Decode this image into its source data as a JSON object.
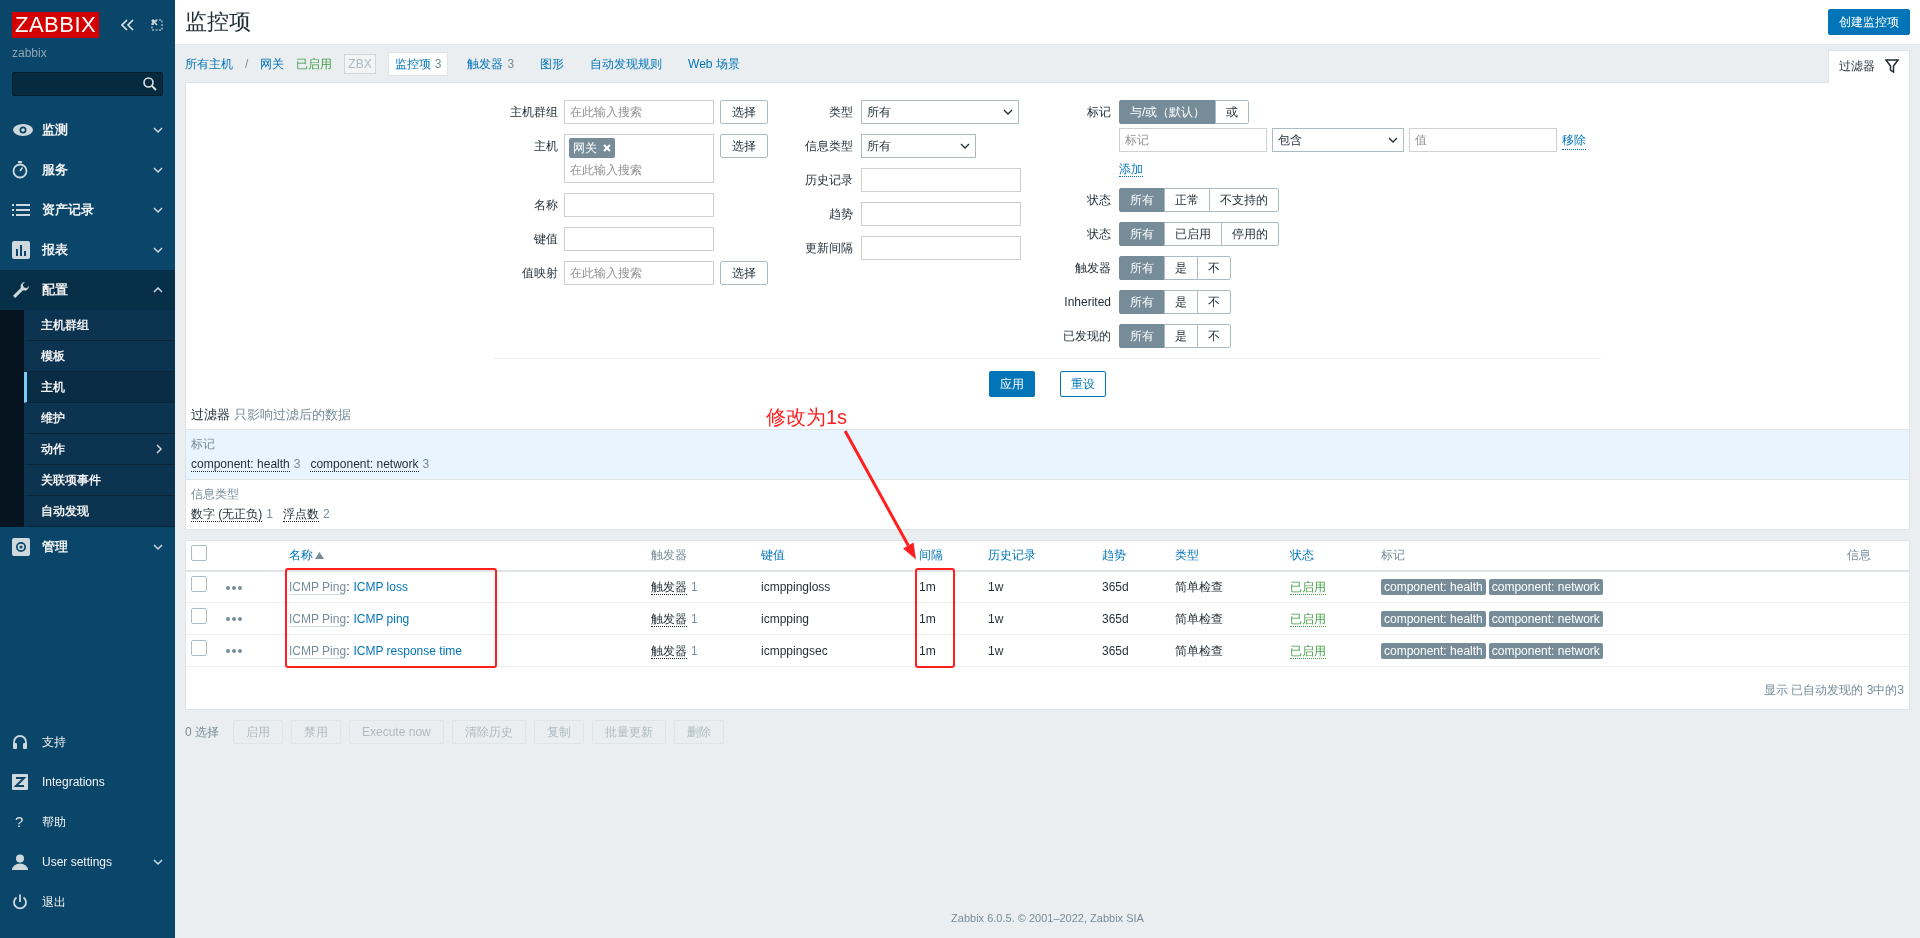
{
  "page": {
    "title": "监控项",
    "create_button": "创建监控项"
  },
  "sidebar": {
    "logo": "ZABBIX",
    "server_name": "zabbix",
    "menu": [
      {
        "label": "监测",
        "expanded": false
      },
      {
        "label": "服务",
        "expanded": false
      },
      {
        "label": "资产记录",
        "expanded": false
      },
      {
        "label": "报表",
        "expanded": false
      },
      {
        "label": "配置",
        "expanded": true,
        "children": [
          {
            "label": "主机群组",
            "selected": false,
            "has_submenu": false
          },
          {
            "label": "模板",
            "selected": false,
            "has_submenu": false
          },
          {
            "label": "主机",
            "selected": true,
            "has_submenu": false
          },
          {
            "label": "维护",
            "selected": false,
            "has_submenu": false
          },
          {
            "label": "动作",
            "selected": false,
            "has_submenu": true
          },
          {
            "label": "关联项事件",
            "selected": false,
            "has_submenu": false
          },
          {
            "label": "自动发现",
            "selected": false,
            "has_submenu": false
          }
        ]
      },
      {
        "label": "管理",
        "expanded": false
      }
    ],
    "bottom": [
      {
        "label": "支持",
        "has_menu": false
      },
      {
        "label": "Integrations",
        "has_menu": false
      },
      {
        "label": "帮助",
        "glyph": "?",
        "has_menu": false
      },
      {
        "label": "User settings",
        "has_menu": true
      },
      {
        "label": "退出",
        "has_menu": false
      }
    ]
  },
  "breadcrumb": {
    "items": [
      {
        "label": "所有主机"
      },
      {
        "label": "网关"
      }
    ],
    "separator": "/",
    "host_status": "已启用",
    "host_enabled": true,
    "availability": "ZBX",
    "available": false
  },
  "tabs": [
    {
      "label": "监控项",
      "count": "3",
      "selected": true
    },
    {
      "label": "触发器",
      "count": "3",
      "selected": false
    },
    {
      "label": "图形",
      "selected": false
    },
    {
      "label": "自动发现规则",
      "selected": false
    },
    {
      "label": "Web 场景",
      "selected": false
    }
  ],
  "filter": {
    "tab_label": "过滤器",
    "column_1": [
      {
        "label": "主机群组",
        "kind": "multiselect",
        "placeholder": "在此输入搜索",
        "button": "选择"
      },
      {
        "label": "主机",
        "kind": "multiselect",
        "chips": [
          "网关"
        ],
        "placeholder": "在此输入搜索",
        "button": "选择"
      },
      {
        "label": "名称",
        "kind": "text"
      },
      {
        "label": "键值",
        "kind": "text"
      },
      {
        "label": "值映射",
        "kind": "multiselect",
        "placeholder": "在此输入搜索",
        "button": "选择"
      }
    ],
    "column_2": [
      {
        "label": "类型",
        "kind": "select",
        "value": "所有"
      },
      {
        "label": "信息类型",
        "kind": "select_short",
        "value": "所有"
      },
      {
        "label": "历史记录",
        "kind": "text"
      },
      {
        "label": "趋势",
        "kind": "text"
      },
      {
        "label": "更新间隔",
        "kind": "text"
      }
    ],
    "tags": {
      "label": "标记",
      "operators": [
        {
          "label": "与/或（默认）",
          "selected": true
        },
        {
          "label": "或",
          "selected": false
        }
      ],
      "tag_placeholder": "标记",
      "operator": "包含",
      "value_placeholder": "值",
      "remove": "移除",
      "add": "添加"
    },
    "radio_groups": [
      {
        "label": "状态",
        "options": [
          {
            "label": "所有",
            "selected": true
          },
          {
            "label": "正常",
            "selected": false
          },
          {
            "label": "不支持的",
            "selected": false
          }
        ]
      },
      {
        "label": "状态",
        "options": [
          {
            "label": "所有",
            "selected": true
          },
          {
            "label": "已启用",
            "selected": false
          },
          {
            "label": "停用的",
            "selected": false
          }
        ]
      },
      {
        "label": "触发器",
        "options": [
          {
            "label": "所有",
            "selected": true
          },
          {
            "label": "是",
            "selected": false
          },
          {
            "label": "不",
            "selected": false
          }
        ]
      },
      {
        "label": "Inherited",
        "options": [
          {
            "label": "所有",
            "selected": true
          },
          {
            "label": "是",
            "selected": false
          },
          {
            "label": "不",
            "selected": false
          }
        ]
      },
      {
        "label": "已发现的",
        "options": [
          {
            "label": "所有",
            "selected": true
          },
          {
            "label": "是",
            "selected": false
          },
          {
            "label": "不",
            "selected": false
          }
        ]
      }
    ],
    "apply_button": "应用",
    "reset_button": "重设"
  },
  "subfilter": {
    "title": "过滤器",
    "note": "只影响过滤后的数据",
    "groups": [
      {
        "label": "标记",
        "highlighted": true,
        "values": [
          {
            "label": "component: health",
            "count": "3"
          },
          {
            "label": "component: network",
            "count": "3"
          }
        ]
      },
      {
        "label": "信息类型",
        "highlighted": false,
        "values": [
          {
            "label": "数字 (无正负)",
            "count": "1"
          },
          {
            "label": "浮点数",
            "count": "2"
          }
        ]
      }
    ]
  },
  "table": {
    "all_checked": false,
    "name_separator": ":",
    "columns": [
      {
        "label": "名称",
        "sortable": true,
        "sorted": true
      },
      {
        "label": "触发器",
        "sortable": false,
        "sorted": false
      },
      {
        "label": "键值",
        "sortable": true,
        "sorted": false
      },
      {
        "label": "间隔",
        "sortable": true,
        "sorted": false
      },
      {
        "label": "历史记录",
        "sortable": true,
        "sorted": false
      },
      {
        "label": "趋势",
        "sortable": true,
        "sorted": false
      },
      {
        "label": "类型",
        "sortable": true,
        "sorted": false
      },
      {
        "label": "状态",
        "sortable": true,
        "sorted": false
      },
      {
        "label": "标记",
        "sortable": false,
        "sorted": false
      },
      {
        "label": "信息",
        "sortable": false,
        "sorted": false
      }
    ],
    "rows": [
      {
        "checked": false,
        "name_prefix": "ICMP Ping",
        "name": "ICMP loss",
        "triggers": "触发器",
        "trigger_count": "1",
        "key": "icmppingloss",
        "interval": "1m",
        "history": "1w",
        "trends": "365d",
        "type": "简单检查",
        "status": "已启用",
        "enabled": true,
        "tags": [
          "component: health",
          "component: network"
        ]
      },
      {
        "checked": false,
        "name_prefix": "ICMP Ping",
        "name": "ICMP ping",
        "triggers": "触发器",
        "trigger_count": "1",
        "key": "icmpping",
        "interval": "1m",
        "history": "1w",
        "trends": "365d",
        "type": "简单检查",
        "status": "已启用",
        "enabled": true,
        "tags": [
          "component: health",
          "component: network"
        ]
      },
      {
        "checked": false,
        "name_prefix": "ICMP Ping",
        "name": "ICMP response time",
        "triggers": "触发器",
        "trigger_count": "1",
        "key": "icmppingsec",
        "interval": "1m",
        "history": "1w",
        "trends": "365d",
        "type": "简单检查",
        "status": "已启用",
        "enabled": true,
        "tags": [
          "component: health",
          "component: network"
        ]
      }
    ],
    "paging": "显示 已自动发现的 3中的3"
  },
  "actions": {
    "selected_count": "0 选择",
    "buttons": [
      {
        "label": "启用",
        "disabled": true
      },
      {
        "label": "禁用",
        "disabled": true
      },
      {
        "label": "Execute now",
        "disabled": true
      },
      {
        "label": "清除历史",
        "disabled": true
      },
      {
        "label": "复制",
        "disabled": true
      },
      {
        "label": "批量更新",
        "disabled": true
      },
      {
        "label": "删除",
        "disabled": true
      }
    ]
  },
  "annotation": {
    "text": "修改为1s"
  },
  "footer": "Zabbix 6.0.5. © 2001–2022, Zabbix SIA"
}
